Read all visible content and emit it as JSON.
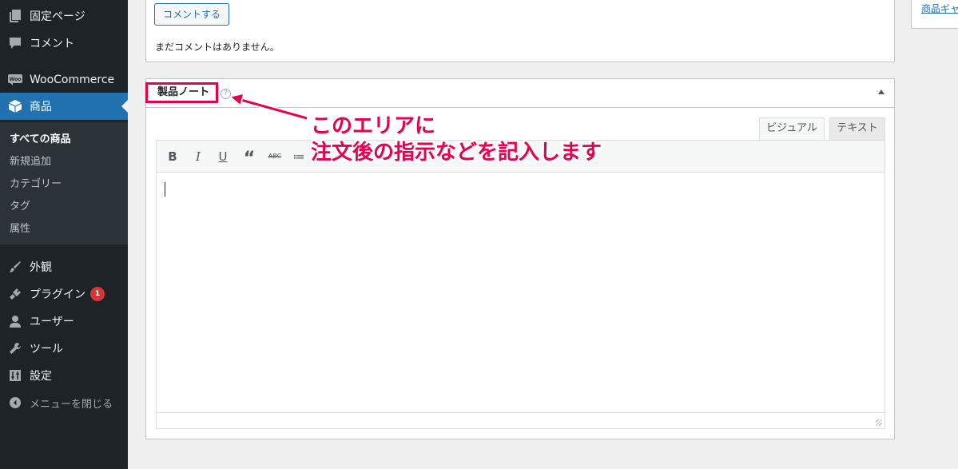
{
  "sidebar": {
    "items": [
      {
        "label": "固定ページ",
        "icon": "page-icon"
      },
      {
        "label": "コメント",
        "icon": "comment-icon"
      },
      {
        "label": "WooCommerce",
        "icon": "woo-icon"
      },
      {
        "label": "商品",
        "icon": "product-box-icon"
      },
      {
        "label": "外観",
        "icon": "brush-icon"
      },
      {
        "label": "プラグイン",
        "icon": "plugin-icon",
        "badge": "1"
      },
      {
        "label": "ユーザー",
        "icon": "user-icon"
      },
      {
        "label": "ツール",
        "icon": "wrench-icon"
      },
      {
        "label": "設定",
        "icon": "settings-icon"
      },
      {
        "label": "メニューを閉じる",
        "icon": "collapse-icon"
      }
    ],
    "submenu": [
      "すべての商品",
      "新規追加",
      "カテゴリー",
      "タグ",
      "属性"
    ]
  },
  "comments": {
    "button_label": "コメントする",
    "empty_text": "まだコメントはありません。"
  },
  "side_panel": {
    "link_text": "商品ギャ"
  },
  "notes": {
    "title": "製品ノート",
    "help_symbol": "?",
    "tabs": {
      "visual": "ビジュアル",
      "text": "テキスト"
    },
    "toolbar": [
      "B",
      "I",
      "U",
      "“",
      "ABC",
      "≔"
    ]
  },
  "annotation": {
    "line1": "このエリアに",
    "line2": "注文後の指示などを記入します",
    "color": "#e5004f"
  },
  "colors": {
    "sidebar_bg": "#1d2327",
    "accent": "#2271b1",
    "highlight": "#e5004f"
  }
}
